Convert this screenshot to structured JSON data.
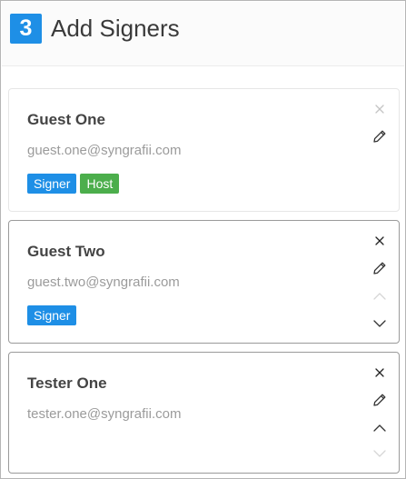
{
  "header": {
    "step_number": "3",
    "title": "Add Signers"
  },
  "colors": {
    "accent": "#1e8fe6",
    "signer_tag": "#1e8fe6",
    "host_tag": "#4cae4c",
    "name_text": "#444444",
    "email_text": "#9b9b9b"
  },
  "signers": [
    {
      "name": "Guest One",
      "email": "guest.one@syngrafii.com",
      "roles": [
        "Signer",
        "Host"
      ]
    },
    {
      "name": "Guest Two",
      "email": "guest.two@syngrafii.com",
      "roles": [
        "Signer"
      ]
    },
    {
      "name": "Tester One",
      "email": "tester.one@syngrafii.com",
      "roles": []
    }
  ]
}
